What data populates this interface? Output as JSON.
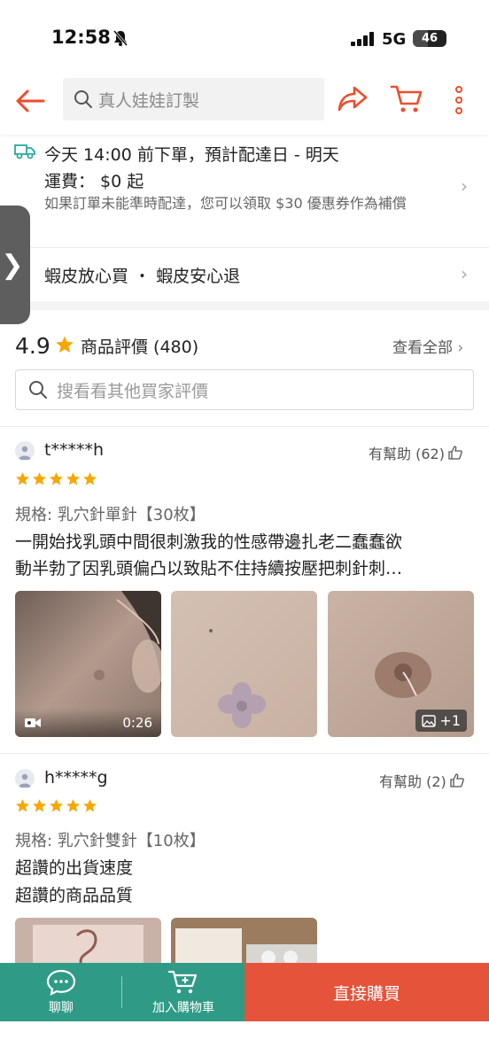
{
  "status_bar": {
    "time": "12:58",
    "network": "5G",
    "battery": "46",
    "battery_level": 0.46
  },
  "header": {
    "search_placeholder": "真人娃娃訂製"
  },
  "delivery": {
    "line1": "今天 14:00 前下單，預計配達日 - 明天",
    "line2": "運費： $0 起",
    "line3": "如果訂單未能準時配達，您可以領取 $30 優惠券作為補償"
  },
  "guarantee": {
    "text": "蝦皮放心買 ・ 蝦皮安心退"
  },
  "ratings": {
    "score": "4.9",
    "label": "商品評價 (480)",
    "see_all": "查看全部",
    "search_placeholder": "搜看看其他買家評價"
  },
  "reviews": [
    {
      "username": "t*****h",
      "helpful": "有幫助 (62)",
      "stars": 5,
      "spec": "規格: 乳穴針單針【30枚】",
      "line1": "一開始找乳頭中間很刺激我的性感帶邊扎老二蠢蠢欲",
      "line2": "動半勃了因乳頭偏凸以致貼不住持續按壓把刺針刺…",
      "video_duration": "0:26",
      "more_count": "+1"
    },
    {
      "username": "h*****g",
      "helpful": "有幫助 (2)",
      "stars": 5,
      "spec": "規格: 乳穴針雙針【10枚】",
      "line1": "超讚的出貨速度",
      "line2": "超讚的商品品質"
    }
  ],
  "bottom_bar": {
    "chat": "聊聊",
    "add_cart": "加入購物車",
    "buy_now": "直接購買"
  },
  "colors": {
    "brand": "#ee4d2d",
    "teal": "#2f9b86",
    "buy": "#e4533a",
    "star": "#f6a700"
  }
}
